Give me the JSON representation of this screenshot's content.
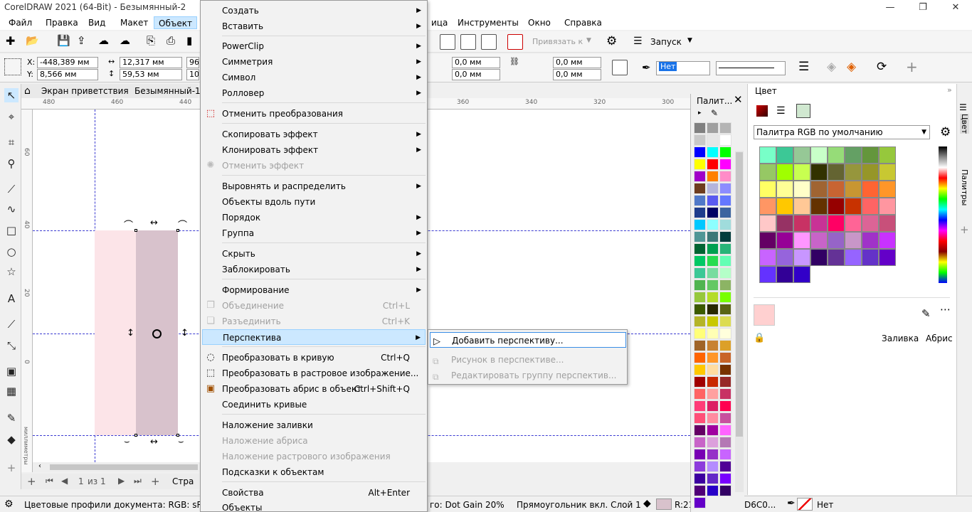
{
  "title": "CorelDRAW 2021 (64-Bit) - Безымянный-2",
  "window_controls": {
    "minimize": "—",
    "restore": "❐",
    "close": "✕"
  },
  "menubar": {
    "items": [
      "Файл",
      "Правка",
      "Вид",
      "Макет",
      "Объект"
    ],
    "right_items": [
      "ица",
      "Инструменты",
      "Окно",
      "Справка"
    ]
  },
  "toolbar1": {
    "snap_label": "Привязать к",
    "launch_label": "Запуск"
  },
  "toolbar2": {
    "x_label": "X:",
    "x_value": "-448,389 мм",
    "y_label": "Y:",
    "y_value": "8,566 мм",
    "w_value": "12,317 мм",
    "h_value": "59,53 мм",
    "scale_w": "96",
    "scale_h": "10",
    "corner_1": "0,0 мм",
    "corner_2": "0,0 мм",
    "corner_3": "0,0 мм",
    "corner_4": "0,0 мм",
    "outline_value": "Нет"
  },
  "doctabs": {
    "welcome": "Экран приветствия",
    "doc": "Безымянный-1"
  },
  "ruler": {
    "h_ticks": [
      "480",
      "460",
      "440",
      "360",
      "340",
      "320",
      "300"
    ],
    "v_ticks": [
      "60",
      "40",
      "20",
      "0"
    ],
    "unit": "миллиметры"
  },
  "pagebar": {
    "page": "1",
    "of": "из 1",
    "page_tab": "Стра"
  },
  "status": {
    "profiles": "Цветовые профили документа: RGB: sRGB IE",
    "dotgain": "го: Dot Gain 20%",
    "selection": "Прямоугольник вкл. Слой 1",
    "fill_code": "R:21",
    "hex_code": "D6C0...",
    "outline": "Нет"
  },
  "palette_strip": {
    "title": "Палит...",
    "colors": [
      "#808080",
      "#a0a0a0",
      "#b4b4b4",
      "#c8c8c8",
      "#e6e6e6",
      "#ffffff",
      "#0000ff",
      "#00ffff",
      "#00ff00",
      "#ffff00",
      "#ff0000",
      "#ff00ff",
      "#a000c8",
      "#ff8000",
      "#ff8cc8",
      "#6e3c1e",
      "#b4b4dc",
      "#8c8cff",
      "#5078c8",
      "#5a5af0",
      "#6478ff",
      "#1e3c8c",
      "#000064",
      "#3c64a0",
      "#00c8ff",
      "#8cffff",
      "#a0dcdc",
      "#509696",
      "#3c7878",
      "#003c3c",
      "#006432",
      "#00a050",
      "#28b478",
      "#00c864",
      "#28dc50",
      "#64ffb4",
      "#3cc896",
      "#78dca0",
      "#b4ffc8",
      "#50b450",
      "#64c864",
      "#8cb464",
      "#96c83c",
      "#b4dc28",
      "#78ff00",
      "#3c5a00",
      "#282800",
      "#5a6414",
      "#b4b428",
      "#c8c800",
      "#dcdc50",
      "#ffff78",
      "#ffffb4",
      "#ffffdc",
      "#a06428",
      "#c88232",
      "#dca028",
      "#ff6400",
      "#ff9628",
      "#c86428",
      "#ffc800",
      "#ffdca0",
      "#783200",
      "#a00000",
      "#c82800",
      "#962828",
      "#ff6464",
      "#ffa0a0",
      "#c83264",
      "#ff3c78",
      "#dc1e64",
      "#ff0050",
      "#ff5078",
      "#ff8ca0",
      "#c8509e",
      "#640064",
      "#a000a0",
      "#ff64ff",
      "#c864c8",
      "#dca0dc",
      "#b478b4",
      "#7800b4",
      "#9632c8",
      "#c864ff",
      "#8c3cdc",
      "#b48cff",
      "#500096",
      "#3c00a0",
      "#6428c8",
      "#7800ff",
      "#500078",
      "#2800c8",
      "#320064",
      "#6400c8"
    ]
  },
  "color_docker": {
    "title": "Цвет",
    "palette_name": "Палитра RGB по умолчанию",
    "fill_label": "Заливка",
    "outline_label": "Абрис",
    "current_color": "#ffd0d0",
    "grid": [
      "#78ffc8",
      "#3cc896",
      "#96c896",
      "#c8ffc8",
      "#96dc78",
      "#64a064",
      "#64963c",
      "#96c83c",
      "#96c864",
      "#a0ff00",
      "#c8ff50",
      "#323200",
      "#646432",
      "#96963c",
      "#969628",
      "#c8c832",
      "#ffff64",
      "#ffff96",
      "#ffffc8",
      "#a06432",
      "#c86432",
      "#c89632",
      "#ff6432",
      "#ff9628",
      "#ff9664",
      "#ffc800",
      "#ffc896",
      "#643200",
      "#960000",
      "#c83200",
      "#ff6464",
      "#ff96a0",
      "#ffc8c8",
      "#963264",
      "#c83264",
      "#c83296",
      "#ff0064",
      "#ff6496",
      "#dc6496",
      "#c8507a",
      "#640064",
      "#960096",
      "#ff96ff",
      "#c864c8",
      "#9664c8",
      "#c896c8",
      "#a032c8",
      "#c832ff",
      "#c864ff",
      "#9664dc",
      "#c896ff",
      "#320064",
      "#643296",
      "#9664ff",
      "#6432c8",
      "#6400c8",
      "#6432ff",
      "#320096",
      "#3200c8"
    ]
  },
  "right_tabs": [
    "Цвет",
    "Палитры"
  ],
  "object_menu": {
    "create": "Создать",
    "insert": "Вставить",
    "powerclip": "PowerClip",
    "symmetry": "Симметрия",
    "symbol": "Символ",
    "rollover": "Ролловер",
    "clear_transforms": "Отменить преобразования",
    "copy_effect": "Скопировать эффект",
    "clone_effect": "Клонировать эффект",
    "cancel_effect": "Отменить эффект",
    "align": "Выровнять и распределить",
    "along_path": "Объекты вдоль пути",
    "order": "Порядок",
    "group": "Группа",
    "hide": "Скрыть",
    "lock": "Заблокировать",
    "shaping": "Формирование",
    "combine": "Объединение",
    "combine_sc": "Ctrl+L",
    "break_apart": "Разъединить",
    "break_apart_sc": "Ctrl+K",
    "perspective": "Перспектива",
    "convert_curves": "Преобразовать в кривую",
    "convert_curves_sc": "Ctrl+Q",
    "convert_bitmap": "Преобразовать в растровое изображение...",
    "outline_to_object": "Преобразовать абрис в объект",
    "outline_to_object_sc": "Ctrl+Shift+Q",
    "join_curves": "Соединить кривые",
    "overprint_fill": "Наложение заливки",
    "overprint_outline": "Наложение абриса",
    "overprint_bitmap": "Наложение растрового изображения",
    "hints": "Подсказки к объектам",
    "properties": "Свойства",
    "properties_sc": "Alt+Enter",
    "objects": "Объекты"
  },
  "perspective_submenu": {
    "add": "Добавить перспективу...",
    "bitmap": "Рисунок в перспективе...",
    "edit_group": "Редактировать группу перспектив..."
  }
}
